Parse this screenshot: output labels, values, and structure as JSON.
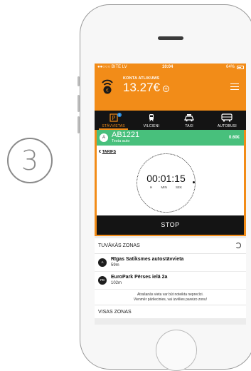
{
  "step": {
    "number": "3"
  },
  "status_bar": {
    "carrier": "●●○○○ BITE LV",
    "time": "10:04",
    "battery": "64%"
  },
  "account": {
    "label": "KONTA ATLIKUMS",
    "balance": "13.27€"
  },
  "tabs": [
    {
      "label": "STĀVVIETAS",
      "icon": "parking-icon",
      "active": true,
      "badge": "1"
    },
    {
      "label": "VILCIENI",
      "icon": "train-icon",
      "active": false
    },
    {
      "label": "TAXI",
      "icon": "taxi-icon",
      "active": false
    },
    {
      "label": "AUTOBUSI",
      "icon": "bus-icon",
      "active": false
    }
  ],
  "parking": {
    "badge": "A",
    "plate": "AB1221",
    "car_name": "Testa auto",
    "price": "0.60€",
    "tarifs_symbol": "€",
    "tarifs_label": "TARIFS",
    "timer": "00:01:15",
    "units": {
      "h": "H",
      "min": "MIN",
      "sek": "SEK"
    },
    "stop_label": "STOP"
  },
  "zones": {
    "title": "TUVĀKĀS ZONAS",
    "items": [
      {
        "icon_label": "A",
        "name": "Rīgas Satiksmes autostāvvieta",
        "distance": "59m"
      },
      {
        "icon_label": "PB",
        "name": "EuroPark Pērses ielā 2a",
        "distance": "102m"
      }
    ],
    "note_line1": "Atrašanās vieta var būt noteikta neprecīzi.",
    "note_line2": "Vienmēr pārliecinies, vai izvēlies pareizo zonu!",
    "all_title": "VISAS ZONAS"
  },
  "colors": {
    "accent": "#f28c18",
    "active_green": "#48c07c",
    "dark": "#141414"
  }
}
